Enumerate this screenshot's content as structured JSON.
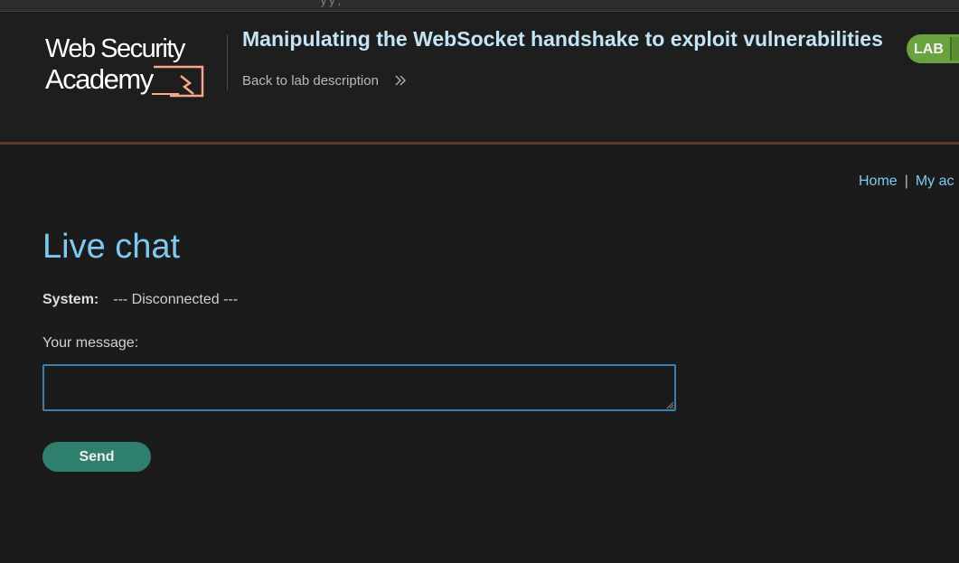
{
  "header": {
    "logo_text_line1": "Web Security",
    "logo_text_line2": "Academy",
    "lab_title": "Manipulating the WebSocket handshake to exploit vulnerabilities",
    "back_link": "Back to lab description",
    "badge": "LAB"
  },
  "nav": {
    "home": "Home",
    "separator": "|",
    "account": "My ac"
  },
  "main": {
    "title": "Live chat",
    "chat": [
      {
        "sender": "System:",
        "text": "--- Disconnected ---"
      }
    ],
    "message_label": "Your message:",
    "message_value": "",
    "send_label": "Send"
  },
  "colors": {
    "background": "#1b1b1b",
    "title_blue": "#7ec9f0",
    "badge_green": "#6aa23f",
    "send_teal": "#2e7f6c",
    "logo_orange": "#f7a78b"
  },
  "icons": [
    "logo-lightning-icon",
    "double-chevron-right-icon",
    "resize-grip-icon"
  ]
}
